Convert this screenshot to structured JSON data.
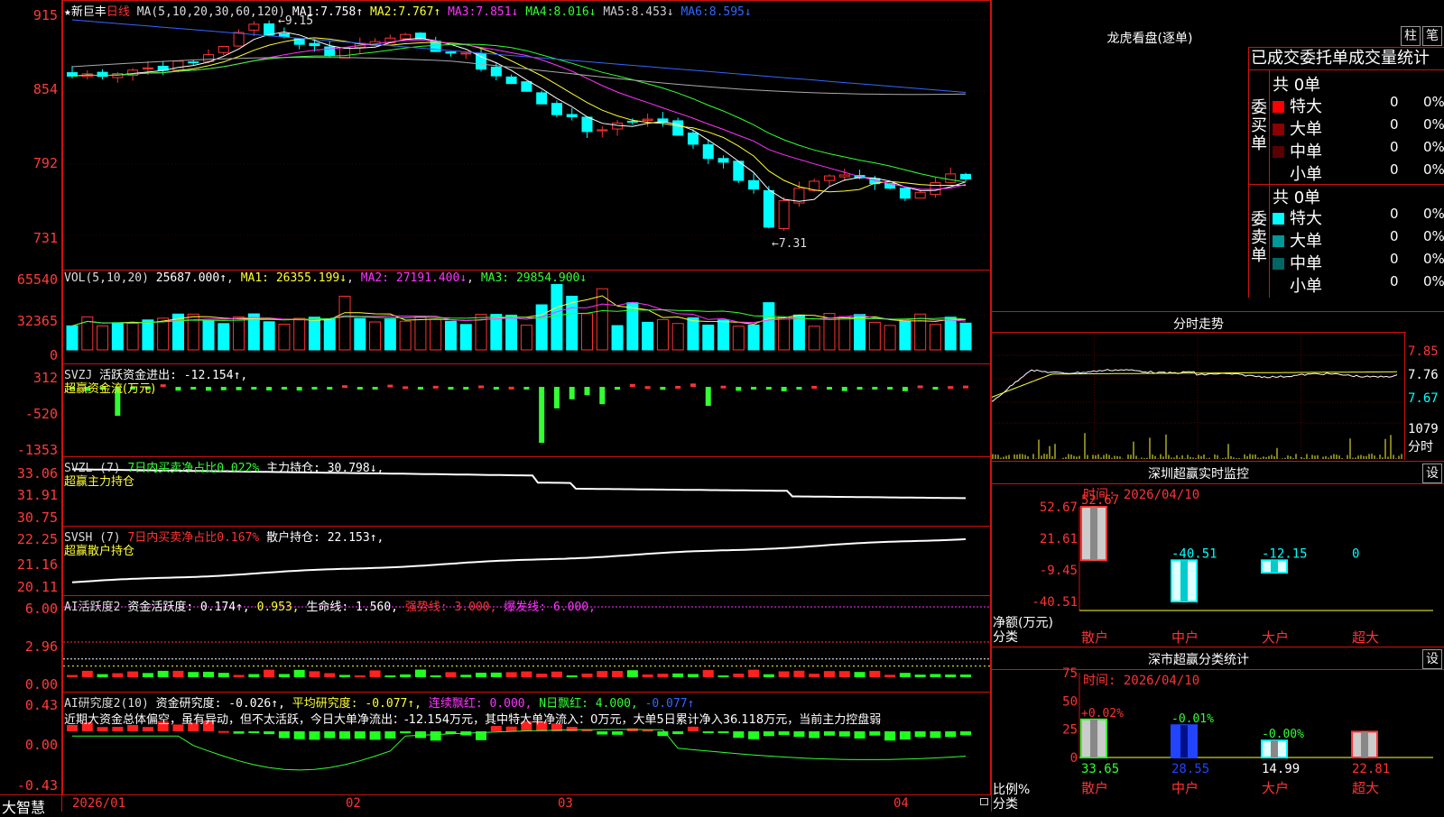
{
  "header": {
    "star": "★",
    "stock_name": "新巨丰",
    "period": "日线",
    "ma_params": "MA(5,10,20,30,60,120)",
    "ma": [
      {
        "label": "MA1:",
        "value": "7.758↑",
        "color": "#ffffff"
      },
      {
        "label": "MA2:",
        "value": "7.767↑",
        "color": "#ffff33"
      },
      {
        "label": "MA3:",
        "value": "7.851↓",
        "color": "#ff33ff"
      },
      {
        "label": "MA4:",
        "value": "8.016↓",
        "color": "#33ff33"
      },
      {
        "label": "MA5:",
        "value": "8.453↓",
        "color": "#cccccc"
      },
      {
        "label": "MA6:",
        "value": "8.595↓",
        "color": "#3366ff"
      }
    ]
  },
  "price_axis": [
    "915",
    "854",
    "792",
    "731"
  ],
  "price_hi_label": "9.15",
  "price_lo_label": "7.31",
  "vol": {
    "params": "VOL(5,10,20)",
    "value": "25687.000↑",
    "ma1": "MA1: 26355.199↓",
    "ma2": "MA2: 27191.400↓",
    "ma3": "MA3: 29854.900↓",
    "axis": [
      "65540",
      "32365",
      "0"
    ]
  },
  "svzj": {
    "name": "SVZJ",
    "label": "活跃资金进出:",
    "value": "-12.154↑,",
    "sub": "超赢资金流(万元)",
    "axis": [
      "312",
      "-520",
      "-1353"
    ]
  },
  "svzl": {
    "name": "SVZL (7)",
    "label1": "7日内买卖净占比0.022%",
    "label2": "主力持仓:",
    "value": "30.798↓,",
    "sub": "超赢主力持仓",
    "axis": [
      "33.06",
      "31.91",
      "30.75"
    ]
  },
  "svsh": {
    "name": "SVSH (7)",
    "label1": "7日内买卖净占比0.167%",
    "label2": "散户持仓:",
    "value": "22.153↑,",
    "sub": "超赢散户持仓",
    "axis": [
      "22.25",
      "21.16",
      "20.11"
    ]
  },
  "ai_active": {
    "name": "AI活跃度2",
    "label": "资金活跃度:",
    "v1": "0.174↑,",
    "v2": "0.953,",
    "life_label": "生命线:",
    "life": "1.560,",
    "strong": "强势线: 3.000,",
    "burst": "爆发线: 6.000,",
    "axis": [
      "6.00",
      "2.96",
      "0.00"
    ]
  },
  "ai_research": {
    "name": "AI研究度2(10)",
    "label": "资金研究度:",
    "v1": "-0.026↑,",
    "avg": "平均研究度: -0.077↑,",
    "cont": "连续飘红: 0.000,",
    "nday": "N日飘红: 4.000,",
    "v2": "-0.077↑",
    "comment": "近期大资金总体偏空，虽有异动，但不太活跃，今日大单净流出：-12.154万元，其中特大单净流入：0万元，大单5日累计净入36.118万元，当前主力控盘弱",
    "axis": [
      "0.43",
      "0.00",
      "-0.43"
    ]
  },
  "x_axis": {
    "brand": "大智慧",
    "dates": [
      "2026/01",
      "02",
      "03",
      "04"
    ]
  },
  "dragon": {
    "title": "龙虎看盘(逐单)",
    "btn1": "柱",
    "btn2": "笔",
    "tabs": "已成交委托单成交量统计",
    "buy_label": "委买单",
    "sell_label": "委卖单",
    "buy_total": "共 0单",
    "sell_total": "共 0单",
    "buy_rows": [
      {
        "name": "特大",
        "count": "0",
        "pct": "0%",
        "color": "#ff0000"
      },
      {
        "name": "大单",
        "count": "0",
        "pct": "0%",
        "color": "#8b0000"
      },
      {
        "name": "中单",
        "count": "0",
        "pct": "0%",
        "color": "#5a0000"
      },
      {
        "name": "小单",
        "count": "0",
        "pct": "0%",
        "color": "#000000"
      }
    ],
    "sell_rows": [
      {
        "name": "特大",
        "count": "0",
        "pct": "0%",
        "color": "#00ffff"
      },
      {
        "name": "大单",
        "count": "0",
        "pct": "0%",
        "color": "#009999"
      },
      {
        "name": "中单",
        "count": "0",
        "pct": "0%",
        "color": "#006666"
      },
      {
        "name": "小单",
        "count": "0",
        "pct": "0%",
        "color": "#000000"
      }
    ]
  },
  "intraday": {
    "title": "分时走势",
    "axis": [
      "7.85",
      "7.76",
      "7.67"
    ],
    "vol_label": "1079",
    "unit_label": "分时"
  },
  "sz_monitor": {
    "title": "深圳超赢实时监控",
    "btn": "设",
    "time": "时间: 2026/04/10",
    "axis": [
      "52.67",
      "21.61",
      "-9.45",
      "-40.51"
    ],
    "unit": "净额(万元)",
    "cat_label": "分类",
    "cats": [
      "散户",
      "中户",
      "大户",
      "超大"
    ],
    "values": [
      52.67,
      -40.51,
      -12.15,
      0
    ],
    "value_labels": [
      "52.67",
      "-40.51",
      "-12.15",
      "0"
    ]
  },
  "sz_class": {
    "title": "深市超赢分类统计",
    "btn": "设",
    "time": "时间: 2026/04/10",
    "axis": [
      "75",
      "50",
      "25",
      "0"
    ],
    "unit": "比例%",
    "cat_label": "分类",
    "cats": [
      "散户",
      "中户",
      "大户",
      "超大"
    ],
    "values": [
      33.65,
      28.55,
      14.99,
      22.81
    ],
    "changes": [
      "+0.02%",
      "-0.01%",
      "-0.00%",
      ""
    ],
    "value_labels": [
      "33.65",
      "28.55",
      "14.99",
      "22.81"
    ]
  }
}
